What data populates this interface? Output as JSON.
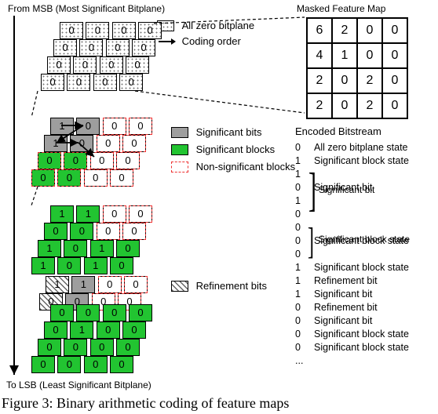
{
  "labels": {
    "msb": "From MSB (Most Significant Bitplane)",
    "lsb": "To LSB (Least Significant Bitplane)",
    "masked_header": "Masked Feature Map",
    "encoded_header": "Encoded Bitstream",
    "allzero_legend": "All zero bitplane",
    "coding_order": "Coding order",
    "sig_bits": "Significant bits",
    "sig_blocks": "Significant blocks",
    "nonsig_blocks": "Non-significant blocks",
    "refinement": "Refinement bits",
    "caption": "Figure 3: Binary arithmetic coding of feature maps"
  },
  "masked_feature_map": [
    [
      6,
      2,
      0,
      0
    ],
    [
      4,
      1,
      0,
      0
    ],
    [
      2,
      0,
      2,
      0
    ],
    [
      2,
      0,
      2,
      0
    ]
  ],
  "bitplanes": {
    "p0": [
      [
        "0",
        "0",
        "0",
        "0"
      ],
      [
        "0",
        "0",
        "0",
        "0"
      ],
      [
        "0",
        "0",
        "0",
        "0"
      ],
      [
        "0",
        "0",
        "0",
        "0"
      ]
    ],
    "p1": [
      [
        "1",
        "0",
        "0",
        "0"
      ],
      [
        "1",
        "0",
        "0",
        "0"
      ],
      [
        "0",
        "0",
        "0",
        "0"
      ],
      [
        "0",
        "0",
        "0",
        "0"
      ]
    ],
    "p2": [
      [
        "1",
        "1",
        "0",
        "0"
      ],
      [
        "0",
        "0",
        "0",
        "0"
      ],
      [
        "1",
        "0",
        "1",
        "0"
      ],
      [
        "1",
        "0",
        "1",
        "0"
      ]
    ],
    "p3": [
      [
        "0",
        "0",
        "0",
        "0"
      ],
      [
        "0",
        "1",
        "0",
        "0"
      ],
      [
        "0",
        "0",
        "0",
        "0"
      ],
      [
        "0",
        "0",
        "0",
        "0"
      ]
    ]
  },
  "encoded_bitstream": [
    {
      "bit": "0",
      "desc": "All zero bitplane state"
    },
    {
      "bit": "1",
      "desc": "Significant block state"
    },
    {
      "bit": "1",
      "desc": ""
    },
    {
      "bit": "0",
      "desc": "Significant bit"
    },
    {
      "bit": "1",
      "desc": ""
    },
    {
      "bit": "0",
      "desc": ""
    },
    {
      "bit": "0",
      "desc": ""
    },
    {
      "bit": "0",
      "desc": "Significant block state"
    },
    {
      "bit": "0",
      "desc": ""
    },
    {
      "bit": "1",
      "desc": "Significant block state"
    },
    {
      "bit": "1",
      "desc": "Refinement bit"
    },
    {
      "bit": "1",
      "desc": "Significant bit"
    },
    {
      "bit": "0",
      "desc": "Refinement bit"
    },
    {
      "bit": "0",
      "desc": "Significant bit"
    },
    {
      "bit": "0",
      "desc": "Significant block state"
    },
    {
      "bit": "0",
      "desc": "Significant block state"
    },
    {
      "bit": "...",
      "desc": ""
    }
  ],
  "brace_groups": {
    "g1": "Significant bit",
    "g2": "Significant block state"
  }
}
